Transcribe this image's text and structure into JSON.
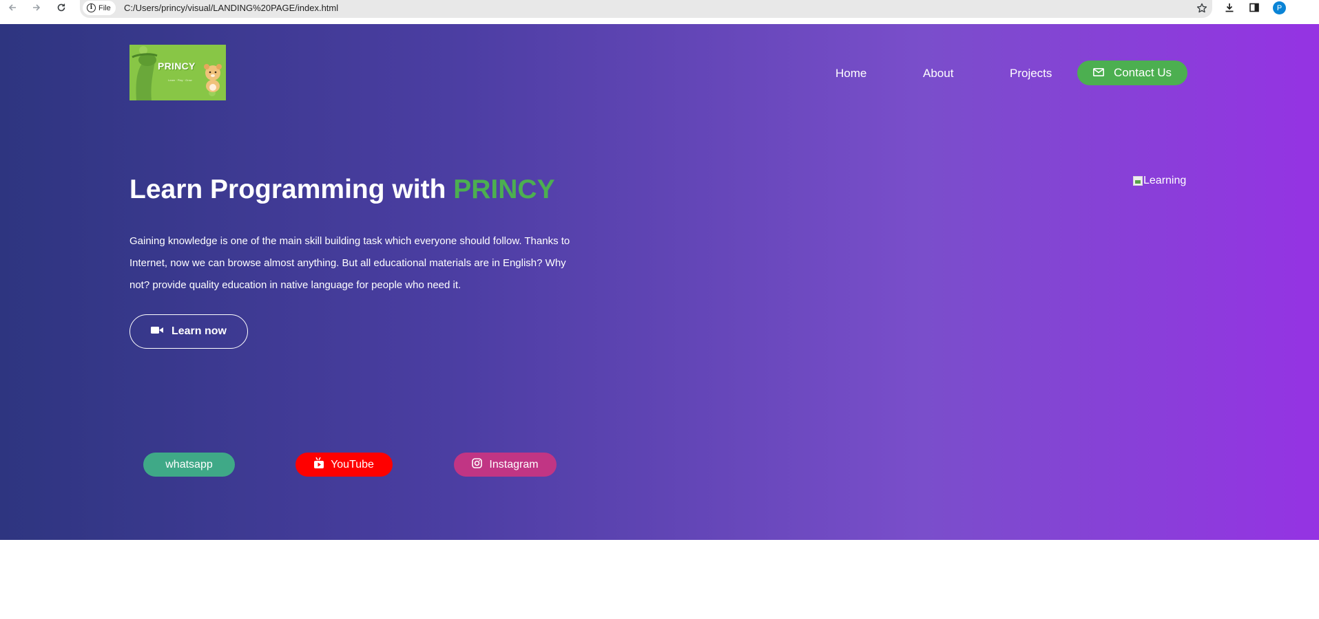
{
  "browser": {
    "site_chip_label": "File",
    "url": "C:/Users/princy/visual/LANDING%20PAGE/index.html",
    "profile_initial": "P",
    "icons": [
      "back-arrow-icon",
      "forward-arrow-icon",
      "reload-icon",
      "info-icon",
      "star-icon",
      "download-icon",
      "side-panel-icon"
    ]
  },
  "logo": {
    "text": "PRINCY",
    "subtext": "Learn · Play · Grow"
  },
  "nav": {
    "home": "Home",
    "about": "About",
    "projects": "Projects",
    "contact": "Contact Us",
    "contact_icon": "envelope-icon"
  },
  "hero": {
    "headline_prefix": "Learn Programming with ",
    "headline_accent": "PRINCY",
    "description": "Gaining knowledge is one of the main skill building task which everyone should follow. Thanks to Internet, now we can browse almost anything. But all educational materials are in English? Why not? provide quality education in native language for people who need it.",
    "cta_label": "Learn now",
    "cta_icon": "video-camera-icon",
    "image_alt": "Learning"
  },
  "social": {
    "whatsapp": "whatsapp",
    "youtube": "YouTube",
    "instagram": "Instagram"
  },
  "colors": {
    "accent_green": "#4caf50",
    "gradient_start": "#2e3580",
    "gradient_end": "#9533e3",
    "whatsapp": "#3fa987",
    "youtube": "#ff0000",
    "instagram": "#c13584"
  }
}
